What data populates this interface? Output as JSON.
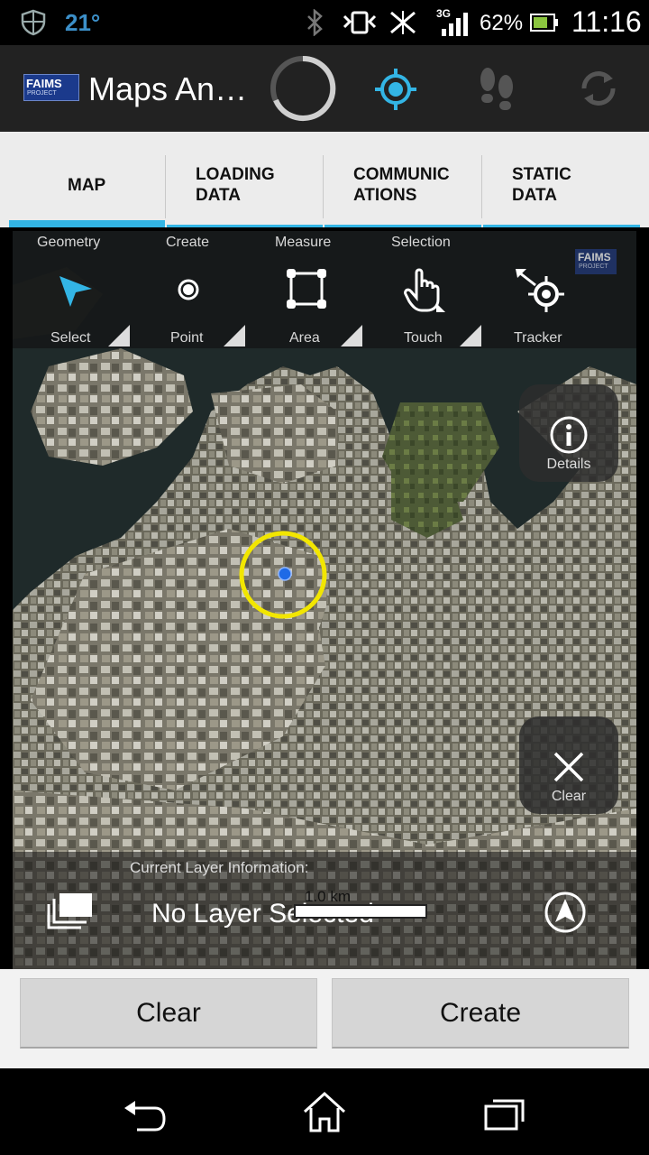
{
  "status_bar": {
    "temperature": "21°",
    "network_type": "3G",
    "battery_percent": "62%",
    "time": "11:16"
  },
  "action_bar": {
    "logo_text": "FAIMS",
    "logo_subtext": "PROJECT",
    "title": "Maps An…"
  },
  "tabs": [
    {
      "line1": "MAP",
      "line2": "",
      "selected": true
    },
    {
      "line1": "LOADING",
      "line2": "DATA",
      "selected": false
    },
    {
      "line1": "COMMUNIC",
      "line2": "ATIONS",
      "selected": false
    },
    {
      "line1": "STATIC",
      "line2": "DATA",
      "selected": false
    }
  ],
  "map_toolbar": {
    "groups": [
      "Geometry",
      "Create",
      "Measure",
      "Selection"
    ],
    "tools": [
      {
        "label": "Select",
        "icon": "arrow-pointer-icon"
      },
      {
        "label": "Point",
        "icon": "point-icon"
      },
      {
        "label": "Area",
        "icon": "polygon-area-icon"
      },
      {
        "label": "Touch",
        "icon": "hand-touch-icon"
      },
      {
        "label": "Tracker",
        "icon": "tracker-icon"
      }
    ],
    "watermark": "FAIMS",
    "watermark_sub": "PROJECT"
  },
  "map_overlays": {
    "details_label": "Details",
    "clear_label": "Clear"
  },
  "layer_info": {
    "heading": "Current Layer Information:",
    "value": "No Layer Selected",
    "scale": "1.0 km"
  },
  "buttons": {
    "clear": "Clear",
    "create": "Create"
  },
  "colors": {
    "accent": "#33b5e5",
    "location_circle": "#f2e600",
    "location_dot": "#1e6ae6"
  }
}
